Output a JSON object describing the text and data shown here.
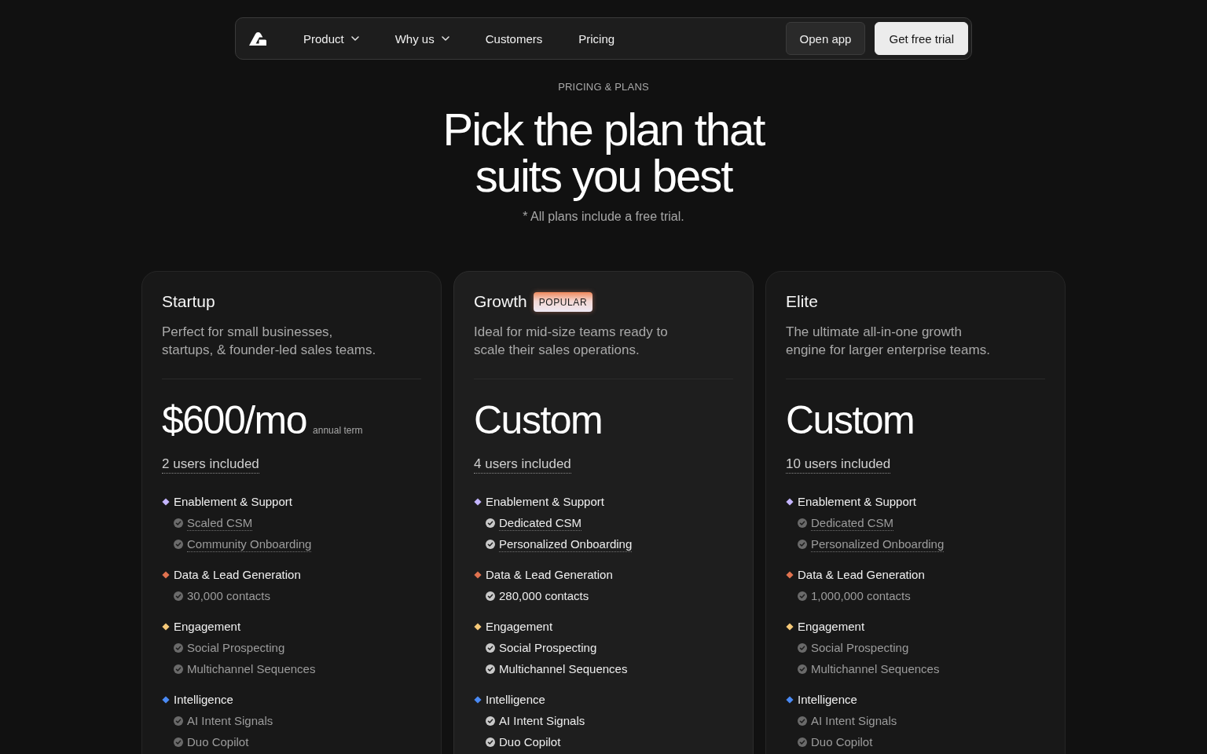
{
  "nav": {
    "links": [
      {
        "label": "Product",
        "dropdown": true
      },
      {
        "label": "Why us",
        "dropdown": true
      },
      {
        "label": "Customers",
        "dropdown": false
      },
      {
        "label": "Pricing",
        "dropdown": false
      }
    ],
    "buttons": [
      {
        "label": "Open app",
        "kind": "secondary"
      },
      {
        "label": "Get free trial",
        "kind": "primary"
      }
    ]
  },
  "hero": {
    "eyebrow": "PRICING & PLANS",
    "title": "Pick the plan that suits you best",
    "note": "* All plans include a free trial."
  },
  "plans": [
    {
      "name": "Startup",
      "featured": false,
      "description": "Perfect for small businesses, startups, & founder-led sales teams.",
      "price": "$600/mo",
      "price_note": "annual term",
      "users": "2 users included",
      "groups": [
        {
          "title": "Enablement & Support",
          "color": "#c4b5fd",
          "items": [
            {
              "label": "Scaled CSM",
              "tooltip": true
            },
            {
              "label": "Community Onboarding",
              "tooltip": true
            }
          ]
        },
        {
          "title": "Data & Lead Generation",
          "color": "#e0724f",
          "items": [
            {
              "label": "30,000 contacts",
              "tooltip": false
            }
          ]
        },
        {
          "title": "Engagement",
          "color": "#f5c978",
          "items": [
            {
              "label": "Social Prospecting",
              "tooltip": false
            },
            {
              "label": "Multichannel Sequences",
              "tooltip": false
            }
          ]
        },
        {
          "title": "Intelligence",
          "color": "#4a8af4",
          "items": [
            {
              "label": "AI Intent Signals",
              "tooltip": false
            },
            {
              "label": "Duo Copilot",
              "tooltip": false
            }
          ]
        }
      ]
    },
    {
      "name": "Growth",
      "badge": "POPULAR",
      "featured": true,
      "description": "Ideal for mid-size teams ready to scale their sales operations.",
      "price": "Custom",
      "users": "4 users included",
      "groups": [
        {
          "title": "Enablement & Support",
          "color": "#c4b5fd",
          "items": [
            {
              "label": "Dedicated CSM",
              "tooltip": true
            },
            {
              "label": "Personalized Onboarding",
              "tooltip": true
            }
          ]
        },
        {
          "title": "Data & Lead Generation",
          "color": "#e0724f",
          "items": [
            {
              "label": "280,000 contacts",
              "tooltip": false
            }
          ]
        },
        {
          "title": "Engagement",
          "color": "#f5c978",
          "items": [
            {
              "label": "Social Prospecting",
              "tooltip": false
            },
            {
              "label": "Multichannel Sequences",
              "tooltip": false
            }
          ]
        },
        {
          "title": "Intelligence",
          "color": "#4a8af4",
          "items": [
            {
              "label": "AI Intent Signals",
              "tooltip": false
            },
            {
              "label": "Duo Copilot",
              "tooltip": false
            }
          ]
        }
      ]
    },
    {
      "name": "Elite",
      "featured": false,
      "description": "The ultimate all-in-one growth engine for larger enterprise teams.",
      "price": "Custom",
      "users": "10 users included",
      "groups": [
        {
          "title": "Enablement & Support",
          "color": "#c4b5fd",
          "items": [
            {
              "label": "Dedicated CSM",
              "tooltip": true
            },
            {
              "label": "Personalized Onboarding",
              "tooltip": true
            }
          ]
        },
        {
          "title": "Data & Lead Generation",
          "color": "#e0724f",
          "items": [
            {
              "label": "1,000,000 contacts",
              "tooltip": false
            }
          ]
        },
        {
          "title": "Engagement",
          "color": "#f5c978",
          "items": [
            {
              "label": "Social Prospecting",
              "tooltip": false
            },
            {
              "label": "Multichannel Sequences",
              "tooltip": false
            }
          ]
        },
        {
          "title": "Intelligence",
          "color": "#4a8af4",
          "items": [
            {
              "label": "AI Intent Signals",
              "tooltip": false
            },
            {
              "label": "Duo Copilot",
              "tooltip": false
            }
          ]
        }
      ]
    }
  ]
}
